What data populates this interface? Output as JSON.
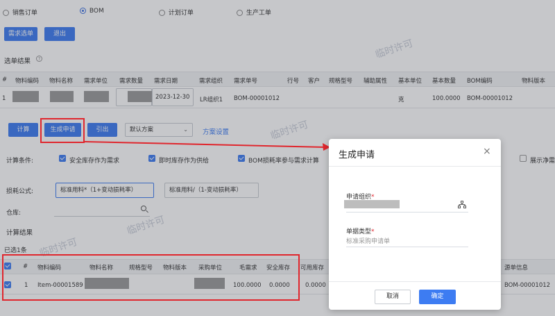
{
  "radios": [
    {
      "label": "销售订单",
      "selected": false
    },
    {
      "label": "BOM",
      "selected": true
    },
    {
      "label": "计划订单",
      "selected": false
    },
    {
      "label": "生产工单",
      "selected": false
    }
  ],
  "toolbar": {
    "select_btn": "需求选单",
    "exit_btn": "退出"
  },
  "result_section": {
    "title": "选单结果"
  },
  "top_table": {
    "headers": [
      "#",
      "物料编码",
      "物料名称",
      "需求单位",
      "需求数量",
      "需求日期",
      "需求组织",
      "需求单号",
      "行号",
      "客户",
      "规格型号",
      "辅助属性",
      "基本单位",
      "基本数量",
      "BOM编码",
      "物料版本"
    ],
    "row": {
      "index": "1",
      "date": "2023-12-30",
      "org": "LR组织1",
      "order_no": "BOM-00001012",
      "unit": "克",
      "qty": "100.0000",
      "bom_code": "BOM-00001012"
    }
  },
  "actions": {
    "calc": "计算",
    "generate": "生成申请",
    "import": "引出",
    "scheme": "默认方案",
    "scheme_settings": "方案设置"
  },
  "calc_conditions": {
    "label": "计算条件:",
    "options": [
      "安全库存作为需求",
      "即时库存作为供给",
      "BOM损耗率参与需求计算"
    ],
    "right_option": "展示净需"
  },
  "loss_formula": {
    "label": "损耗公式:",
    "option1": "标准用料*（1+变动损耗率）",
    "option2": "标准用料/（1-变动损耗率）"
  },
  "warehouse": {
    "label": "仓库:"
  },
  "calc_result": {
    "title": "计算结果",
    "selected_count": "已选1条"
  },
  "bottom_table": {
    "headers": [
      "#",
      "物料编码",
      "物料名称",
      "规格型号",
      "物料版本",
      "采购单位",
      "毛需求",
      "安全库存",
      "可用库存"
    ],
    "right_header": "源单信息",
    "row": {
      "index": "1",
      "code": "Item-00001589",
      "gross": "100.0000",
      "safety": "0.0000",
      "available": "0.0000",
      "source": "BOM-00001012"
    }
  },
  "watermark": "临时许可",
  "modal": {
    "title": "生成申请",
    "org_label": "申请组织",
    "type_label": "单据类型",
    "type_value": "标准采购申请单",
    "cancel": "取消",
    "confirm": "确定"
  },
  "colors": {
    "accent": "#3d7cf2",
    "highlight": "#e0262d"
  }
}
